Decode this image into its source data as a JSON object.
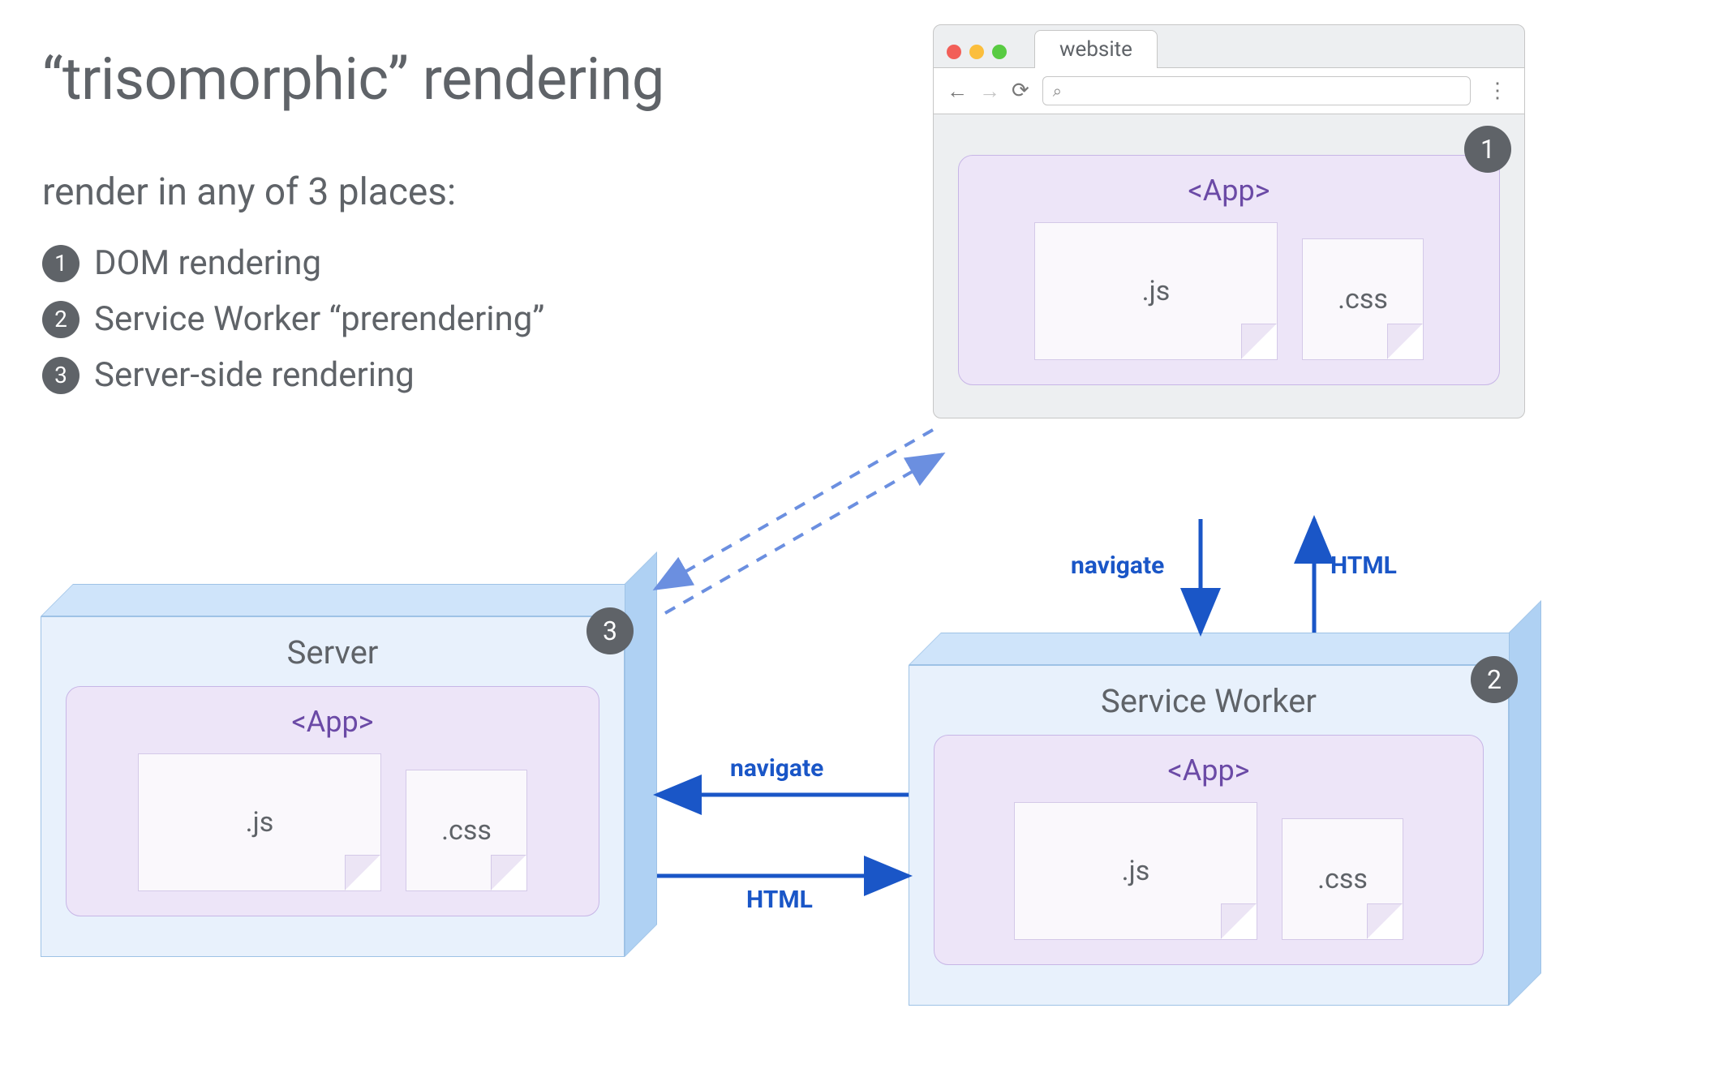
{
  "heading": "“trisomorphic” rendering",
  "subheading": "render in any of 3 places:",
  "items": [
    {
      "n": "1",
      "label": "DOM rendering"
    },
    {
      "n": "2",
      "label": "Service Worker “prerendering”"
    },
    {
      "n": "3",
      "label": "Server-side rendering"
    }
  ],
  "browser": {
    "tab_label": "website",
    "badge": "1",
    "app_label": "<App>",
    "file_js": ".js",
    "file_css": ".css",
    "search_glyph": "⌕"
  },
  "server": {
    "title": "Server",
    "badge": "3",
    "app_label": "<App>",
    "file_js": ".js",
    "file_css": ".css"
  },
  "sw": {
    "title": "Service Worker",
    "badge": "2",
    "app_label": "<App>",
    "file_js": ".js",
    "file_css": ".css"
  },
  "arrows": {
    "navigate_down": "navigate",
    "html_up": "HTML",
    "navigate_left": "navigate",
    "html_right": "HTML"
  },
  "colors": {
    "blue_arrow": "#1a56c7",
    "box_bg": "#e8f1fc",
    "box_border": "#9ec2e6",
    "purple_bg": "#ede5f8",
    "purple_border": "#c7b6e6",
    "badge": "#5f6368"
  }
}
